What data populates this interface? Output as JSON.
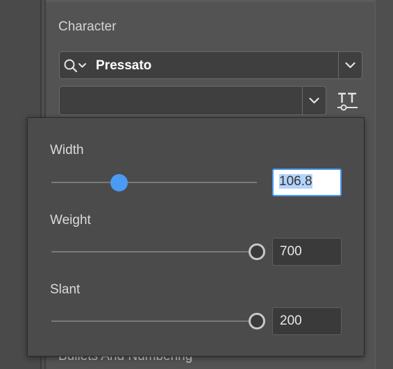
{
  "panel": {
    "section_title": "Character",
    "font_family": "Pressato",
    "font_style": "",
    "bottom_section_title": "Bullets And Numbering"
  },
  "variable_font_popover": {
    "axes": [
      {
        "label": "Width",
        "value": "106.8",
        "fraction": 0.33,
        "focused": true
      },
      {
        "label": "Weight",
        "value": "700",
        "fraction": 1.0,
        "focused": false
      },
      {
        "label": "Slant",
        "value": "200",
        "fraction": 1.0,
        "focused": false
      }
    ]
  },
  "colors": {
    "accent": "#4b9bf5",
    "panel_bg": "#535353",
    "popover_bg": "#4b4b4b",
    "field_bg": "#3f3f3f"
  },
  "icons": {
    "search": "search-icon",
    "dropdown": "chevron-down-icon",
    "variable_font": "variable-font-icon"
  }
}
